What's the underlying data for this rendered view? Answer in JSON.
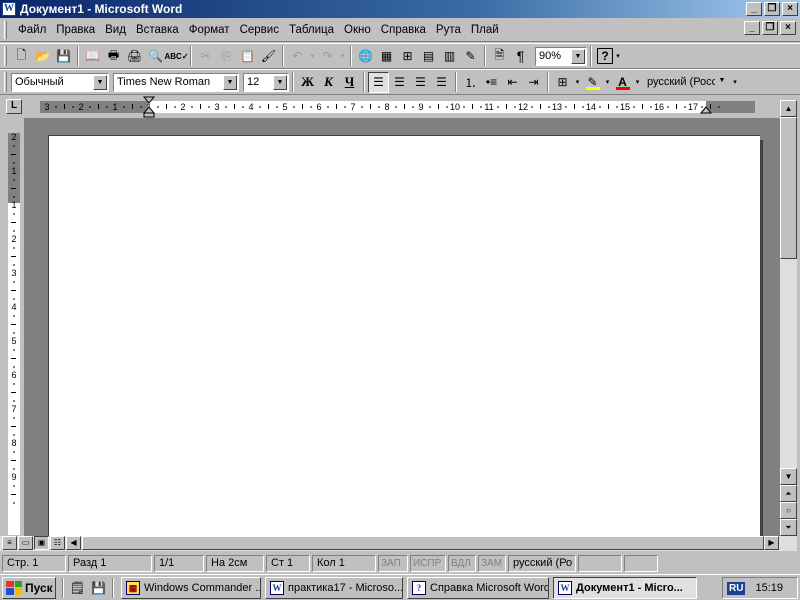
{
  "window": {
    "title": "Документ1 - Microsoft Word",
    "app_icon": "W"
  },
  "menu": [
    "Файл",
    "Правка",
    "Вид",
    "Вставка",
    "Формат",
    "Сервис",
    "Таблица",
    "Окно",
    "Справка",
    "Рута",
    "Плай"
  ],
  "standard_toolbar": {
    "zoom": "90%",
    "help": "?",
    "pilcrow": "¶"
  },
  "format_toolbar": {
    "style": "Обычный",
    "font": "Times New Roman",
    "size": "12",
    "bold": "Ж",
    "italic": "К",
    "underline": "Ч",
    "language": "русский (Росс",
    "highlight_color": "#ffff00",
    "font_color": "#ff0000"
  },
  "ruler": {
    "h_ticks": [
      "3",
      "2",
      "1",
      "1",
      "2",
      "3",
      "4",
      "5",
      "6",
      "7",
      "8",
      "9",
      "10",
      "11",
      "12",
      "13",
      "14",
      "15",
      "16",
      "17"
    ],
    "v_ticks": [
      "2",
      "1",
      "1",
      "2",
      "3",
      "4",
      "5",
      "6",
      "7",
      "8",
      "9"
    ]
  },
  "status": {
    "page": "Стр. 1",
    "section": "Разд 1",
    "pages": "1/1",
    "at": "На 2см",
    "line": "Ст 1",
    "col": "Кол 1",
    "rec": "ЗАП",
    "trk": "ИСПР",
    "ext": "ВДЛ",
    "ovr": "ЗАМ",
    "lang": "русский (Ро"
  },
  "taskbar": {
    "start": "Пуск",
    "tasks": [
      {
        "label": "Windows Commander ...",
        "active": false
      },
      {
        "label": "практика17 - Microso...",
        "active": false
      },
      {
        "label": "Справка Microsoft Word",
        "active": false
      },
      {
        "label": "Документ1 - Micro...",
        "active": true
      }
    ],
    "lang": "RU",
    "clock": "15:19"
  }
}
